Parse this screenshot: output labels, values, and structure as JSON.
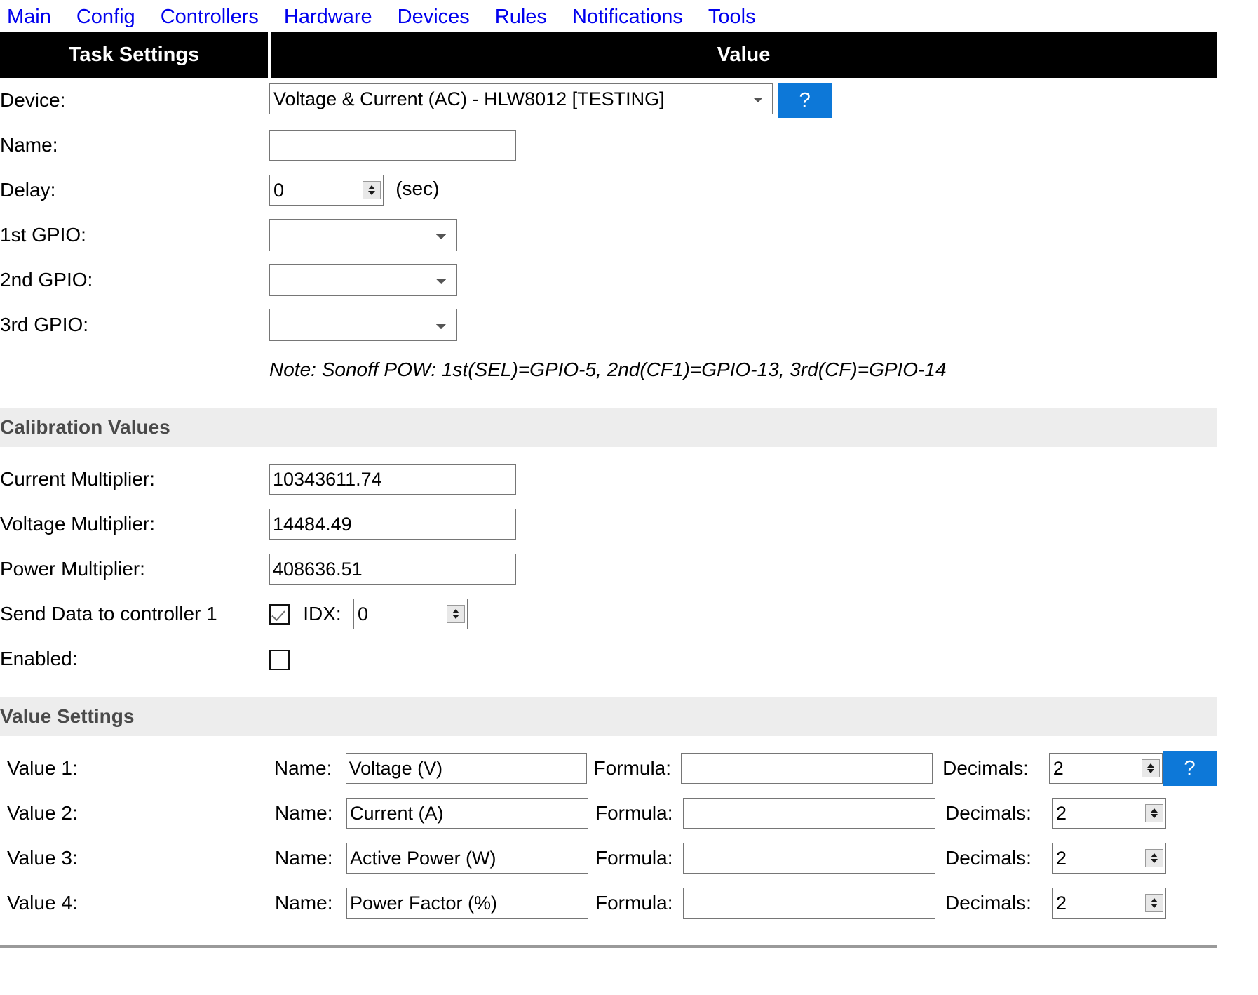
{
  "nav": {
    "items": [
      {
        "label": "Main"
      },
      {
        "label": "Config"
      },
      {
        "label": "Controllers"
      },
      {
        "label": "Hardware"
      },
      {
        "label": "Devices"
      },
      {
        "label": "Rules"
      },
      {
        "label": "Notifications"
      },
      {
        "label": "Tools"
      }
    ]
  },
  "table_header": {
    "left": "Task Settings",
    "right": "Value"
  },
  "task_settings": {
    "device": {
      "label": "Device:",
      "selected": "Voltage & Current (AC) - HLW8012 [TESTING]",
      "options": [
        "Voltage & Current (AC) - HLW8012 [TESTING]"
      ],
      "help_label": "?"
    },
    "name": {
      "label": "Name:",
      "value": "",
      "placeholder": ""
    },
    "delay": {
      "label": "Delay:",
      "value": "0",
      "unit": "(sec)"
    },
    "gpio1": {
      "label": "1st GPIO:",
      "selected": "",
      "options": [
        ""
      ]
    },
    "gpio2": {
      "label": "2nd GPIO:",
      "selected": "",
      "options": [
        ""
      ]
    },
    "gpio3": {
      "label": "3rd GPIO:",
      "selected": "",
      "options": [
        ""
      ]
    },
    "note": "Note: Sonoff POW: 1st(SEL)=GPIO-5, 2nd(CF1)=GPIO-13, 3rd(CF)=GPIO-14"
  },
  "calibration": {
    "section_title": "Calibration Values",
    "current_multiplier": {
      "label": "Current Multiplier:",
      "value": "10343611.74"
    },
    "voltage_multiplier": {
      "label": "Voltage Multiplier:",
      "value": "14484.49"
    },
    "power_multiplier": {
      "label": "Power Multiplier:",
      "value": "408636.51"
    },
    "send_data": {
      "label": "Send Data to controller 1",
      "checked": true,
      "idx_label": "IDX:",
      "idx_value": "0"
    },
    "enabled": {
      "label": "Enabled:",
      "checked": false
    }
  },
  "value_settings": {
    "section_title": "Value Settings",
    "col_name_label": "Name:",
    "col_formula_label": "Formula:",
    "col_decimals_label": "Decimals:",
    "help_label": "?",
    "rows": [
      {
        "label": "Value 1:",
        "name": "Voltage (V)",
        "formula": "",
        "decimals": "2"
      },
      {
        "label": "Value 2:",
        "name": "Current (A)",
        "formula": "",
        "decimals": "2"
      },
      {
        "label": "Value 3:",
        "name": "Active Power (W)",
        "formula": "",
        "decimals": "2"
      },
      {
        "label": "Value 4:",
        "name": "Power Factor (%)",
        "formula": "",
        "decimals": "2"
      }
    ]
  },
  "colors": {
    "nav_link": "#0000ee",
    "header_bg": "#000000",
    "header_text": "#ffffff",
    "section_band": "#ededed",
    "section_text": "#4a4a4a",
    "help_button": "#0d78d8"
  }
}
